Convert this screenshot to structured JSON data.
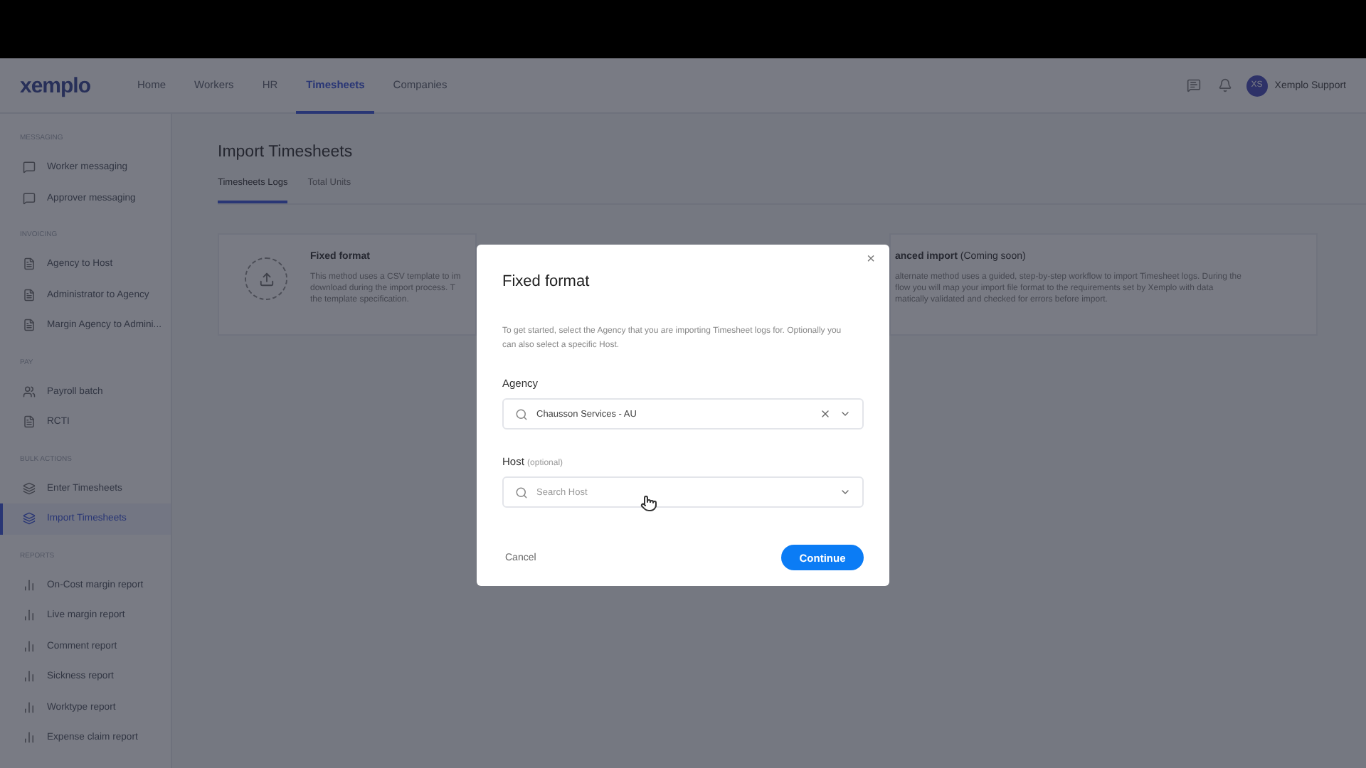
{
  "topbar": {
    "logo": "xemplo",
    "nav": [
      {
        "label": "Home",
        "selected": false
      },
      {
        "label": "Workers",
        "selected": false
      },
      {
        "label": "HR",
        "selected": false
      },
      {
        "label": "Timesheets",
        "selected": true
      },
      {
        "label": "Companies",
        "selected": false
      }
    ],
    "user": {
      "initials": "XS",
      "name": "Xemplo Support"
    }
  },
  "sidebar": {
    "sections": [
      {
        "title": "MESSAGING",
        "items": [
          {
            "label": "Worker messaging",
            "kind": "chat",
            "selected": false
          },
          {
            "label": "Approver messaging",
            "kind": "chat",
            "selected": false
          }
        ]
      },
      {
        "title": "INVOICING",
        "items": [
          {
            "label": "Agency to Host",
            "kind": "doc",
            "selected": false
          },
          {
            "label": "Administrator to Agency",
            "kind": "doc",
            "selected": false
          },
          {
            "label": "Margin Agency to Admini...",
            "kind": "doc",
            "selected": false
          }
        ]
      },
      {
        "title": "PAY",
        "items": [
          {
            "label": "Payroll batch",
            "kind": "people",
            "selected": false
          },
          {
            "label": "RCTI",
            "kind": "doc",
            "selected": false
          }
        ]
      },
      {
        "title": "BULK ACTIONS",
        "items": [
          {
            "label": "Enter Timesheets",
            "kind": "stack",
            "selected": false
          },
          {
            "label": "Import Timesheets",
            "kind": "stack",
            "selected": true
          }
        ]
      },
      {
        "title": "REPORTS",
        "items": [
          {
            "label": "On-Cost margin report",
            "kind": "chart",
            "selected": false
          },
          {
            "label": "Live margin report",
            "kind": "chart",
            "selected": false
          },
          {
            "label": "Comment report",
            "kind": "chart",
            "selected": false
          },
          {
            "label": "Sickness report",
            "kind": "chart",
            "selected": false
          },
          {
            "label": "Worktype report",
            "kind": "chart",
            "selected": false
          },
          {
            "label": "Expense claim report",
            "kind": "chart",
            "selected": false
          }
        ]
      }
    ]
  },
  "page": {
    "title": "Import Timesheets",
    "tabs": [
      {
        "label": "Timesheets Logs",
        "selected": true
      },
      {
        "label": "Total Units",
        "selected": false
      }
    ],
    "cards": [
      {
        "title": "Fixed format",
        "lines": [
          "This method uses a CSV template to im",
          "download during the import process. T",
          "the template specification."
        ]
      },
      {
        "title": "anced import",
        "note": "(Coming soon)",
        "lines": [
          "alternate method uses a guided, step-by-step workflow to import Timesheet logs. During the",
          "flow you will map your import file format to the requirements set by Xemplo with data",
          "matically validated and checked for errors before import."
        ]
      }
    ]
  },
  "dialog": {
    "close": "×",
    "title": "Fixed format",
    "description": "To get started, select the Agency that you are importing Timesheet logs for. Optionally you can also select a specific Host.",
    "fields": [
      {
        "label": "Agency",
        "value": "Chausson Services - AU",
        "clearable": true
      },
      {
        "label": "Host",
        "hint": "(optional)",
        "placeholder": "Search Host",
        "clearable": false
      }
    ],
    "cancel": "Cancel",
    "confirm": "Continue"
  }
}
